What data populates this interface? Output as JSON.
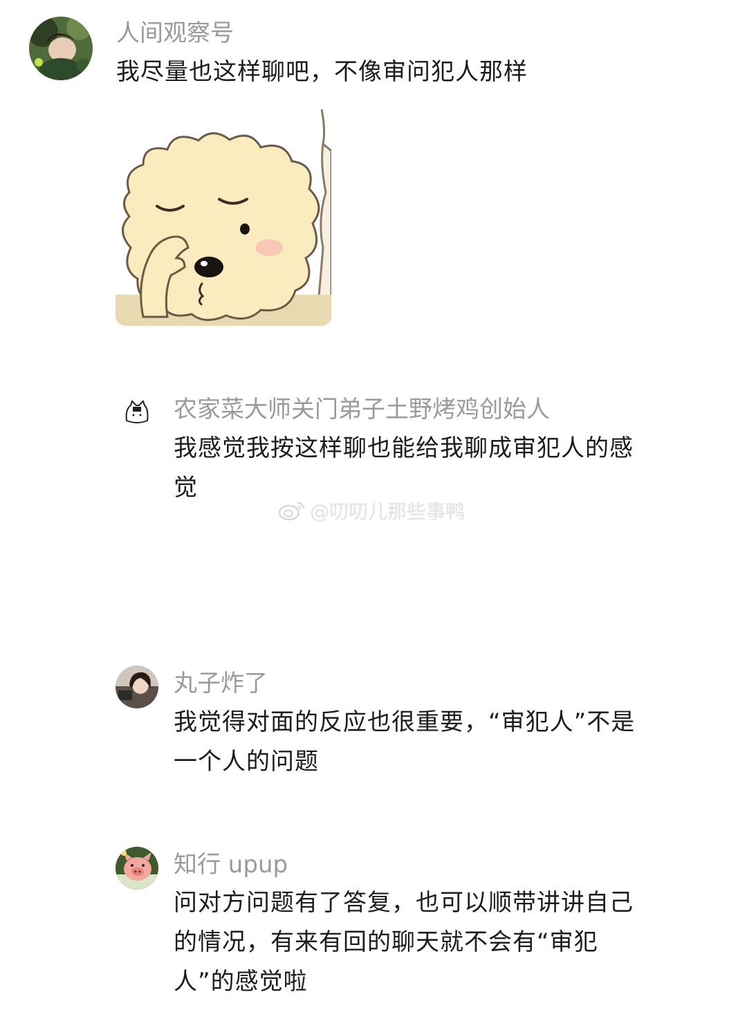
{
  "comments": [
    {
      "username": "人间观察号",
      "text": "我尽量也这样聊吧，不像审问犯人那样",
      "avatar_icon": "user-avatar-photo"
    },
    {
      "username": "农家菜大师关门弟子土野烤鸡创始人",
      "text": "我感觉我按这样聊也能给我聊成审犯人的感觉",
      "avatar_icon": "cartoon-cat-avatar"
    },
    {
      "username": "丸子炸了",
      "text": "我觉得对面的反应也很重要，“审犯人”不是一个人的问题",
      "avatar_icon": "user-avatar-photo"
    },
    {
      "username": "知行 upup",
      "text": "问对方问题有了答复，也可以顺带讲讲自己的情况，有来有回的聊天就不会有“审犯人”的感觉啦",
      "avatar_icon": "pig-avatar"
    }
  ],
  "watermark": {
    "text": "@叨叨儿那些事鸭",
    "icon": "weibo-icon"
  },
  "sticker": {
    "icon": "sheep-sticker"
  }
}
